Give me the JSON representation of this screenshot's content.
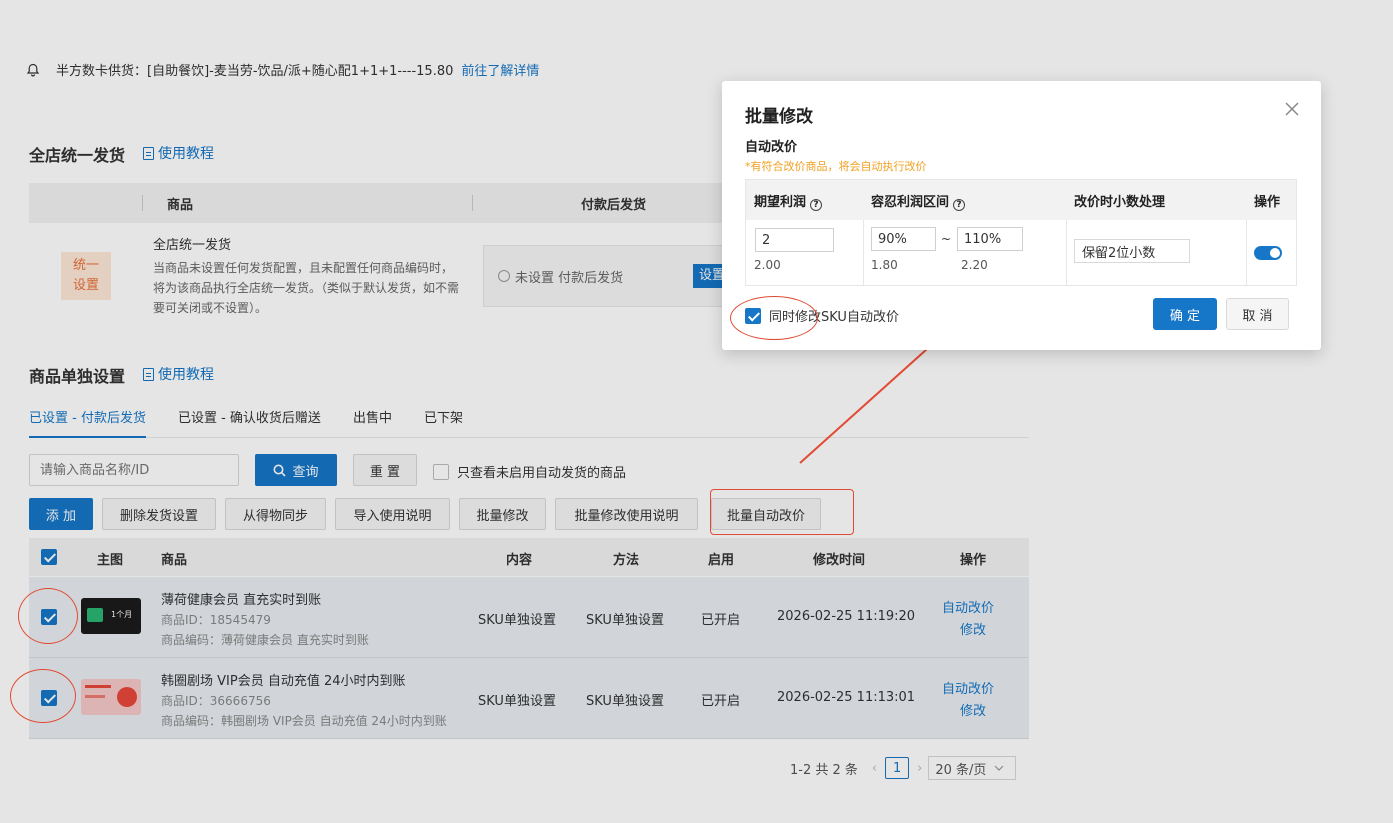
{
  "notice": {
    "text": "半方数卡供货：[自助餐饮]-麦当劳-饮品/派+随心配1+1+1----15.80",
    "link": "前往了解详情"
  },
  "unified": {
    "title": "全店统一发货",
    "tutorial": "使用教程",
    "col_product": "商品",
    "col_after_pay": "付款后发货",
    "badge": "统一设置",
    "item_title": "全店统一发货",
    "item_desc": "当商品未设置任何发货配置，且未配置任何商品编码时，将为该商品执行全店统一发货。（类似于默认发货，如不需要可关闭或不设置）。",
    "status": "未设置 付款后发货",
    "set_btn": "设置"
  },
  "single": {
    "title": "商品单独设置",
    "tutorial": "使用教程",
    "tabs": [
      "已设置 - 付款后发货",
      "已设置 - 确认收货后赠送",
      "出售中",
      "已下架"
    ]
  },
  "filters": {
    "search_placeholder": "请输入商品名称/ID",
    "query": "查询",
    "reset": "重 置",
    "only_disabled": "只查看未启用自动发货的商品"
  },
  "toolbar": {
    "add": "添 加",
    "delete_cfg": "删除发货设置",
    "sync": "从得物同步",
    "import_help": "导入使用说明",
    "batch_edit": "批量修改",
    "batch_help": "批量修改使用说明",
    "batch_auto_price": "批量自动改价"
  },
  "list": {
    "headers": {
      "main_img": "主图",
      "product": "商品",
      "content": "内容",
      "method": "方法",
      "enabled": "启用",
      "modified": "修改时间",
      "action": "操作"
    },
    "rows": [
      {
        "name": "薄荷健康会员 直充实时到账",
        "id": "商品ID：18545479",
        "code": "商品编码：薄荷健康会员 直充实时到账",
        "content": "SKU单独设置",
        "method": "SKU单独设置",
        "enabled": "已开启",
        "modified": "2026-02-25 11:19:20",
        "op1": "自动改价",
        "op2": "修改",
        "thumb_text": "1个月"
      },
      {
        "name": "韩圈剧场 VIP会员 自动充值 24小时内到账",
        "id": "商品ID：36666756",
        "code": "商品编码：韩圈剧场 VIP会员 自动充值 24小时内到账",
        "content": "SKU单独设置",
        "method": "SKU单独设置",
        "enabled": "已开启",
        "modified": "2026-02-25 11:13:01",
        "op1": "自动改价",
        "op2": "修改"
      }
    ]
  },
  "pager": {
    "summary": "1-2 共 2 条",
    "current": "1",
    "page_size": "20 条/页"
  },
  "modal": {
    "title": "批量修改",
    "section": "自动改价",
    "hint": "*有符合改价商品，将会自动执行改价",
    "col_profit": "期望利润",
    "col_tolerance": "容忍利润区间",
    "col_decimal": "改价时小数处理",
    "col_action": "操作",
    "profit_value": "2",
    "profit_calc": "2.00",
    "tol_low": "90%",
    "tol_sep": "~",
    "tol_high": "110%",
    "tol_low_calc": "1.80",
    "tol_high_calc": "2.20",
    "decimal_option": "保留2位小数",
    "sync_sku": "同时修改SKU自动改价",
    "ok": "确 定",
    "cancel": "取 消"
  },
  "colors": {
    "primary": "#1677c8",
    "annotation": "#e24a33",
    "hint": "#f0a020"
  }
}
